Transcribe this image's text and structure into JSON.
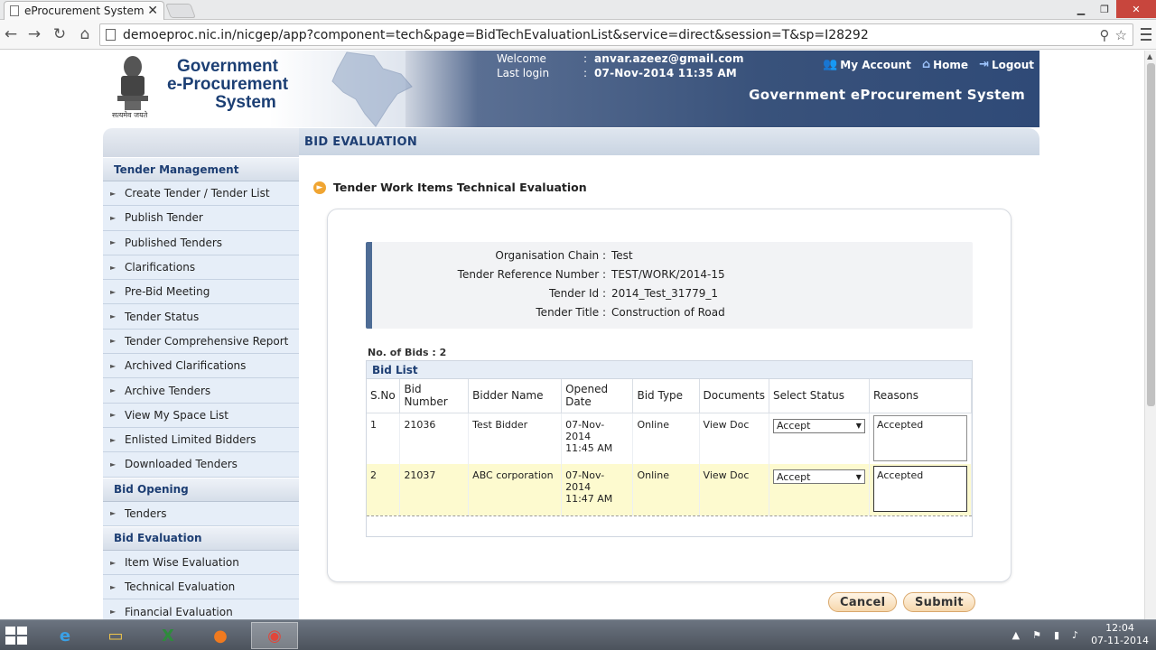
{
  "browser": {
    "tab_title": "eProcurement System",
    "tab_close": "✕",
    "url": "demoeproc.nic.in/nicgep/app?component=tech&page=BidTechEvaluationList&service=direct&session=T&sp=I28292"
  },
  "header": {
    "logo_lines": [
      "Government",
      "e-Procurement",
      "System"
    ],
    "emblem_caption": "सत्यमेव जयते",
    "welcome_label": "Welcome",
    "welcome_value": "anvar.azeez@gmail.com",
    "last_login_label": "Last login",
    "last_login_value": "07-Nov-2014 11:35 AM",
    "links": {
      "my_account": "My Account",
      "home": "Home",
      "logout": "Logout"
    },
    "system_title": "Government eProcurement System"
  },
  "sidebar": {
    "groups": [
      {
        "title": "Tender Management",
        "items": [
          "Create Tender / Tender List",
          "Publish Tender",
          "Published Tenders",
          "Clarifications",
          "Pre-Bid Meeting",
          "Tender Status",
          "Tender Comprehensive Report",
          "Archived Clarifications",
          "Archive Tenders",
          "View My Space List",
          "Enlisted Limited Bidders",
          "Downloaded Tenders"
        ]
      },
      {
        "title": "Bid Opening",
        "items": [
          "Tenders"
        ]
      },
      {
        "title": "Bid Evaluation",
        "items": [
          "Item Wise Evaluation",
          "Technical Evaluation",
          "Financial Evaluation"
        ]
      }
    ]
  },
  "main": {
    "heading": "BID EVALUATION",
    "section_title": "Tender Work Items Technical Evaluation",
    "info": {
      "org_label": "Organisation Chain :",
      "org_value": "Test",
      "ref_label": "Tender Reference Number :",
      "ref_value": "TEST/WORK/2014-15",
      "id_label": "Tender Id :",
      "id_value": "2014_Test_31779_1",
      "title_label": "Tender Title :",
      "title_value": "Construction of Road"
    },
    "bids_count": "No. of Bids : 2",
    "bid_list_title": "Bid List",
    "columns": [
      "S.No",
      "Bid Number",
      "Bidder Name",
      "Opened Date",
      "Bid Type",
      "Documents",
      "Select Status",
      "Reasons"
    ],
    "rows": [
      {
        "sno": "1",
        "bid_number": "21036",
        "bidder": "Test Bidder",
        "date": "07-Nov-2014",
        "time": "11:45 AM",
        "type": "Online",
        "docs": "View Doc",
        "status": "Accept",
        "reason": "Accepted"
      },
      {
        "sno": "2",
        "bid_number": "21037",
        "bidder": "ABC corporation",
        "date": "07-Nov-2014",
        "time": "11:47 AM",
        "type": "Online",
        "docs": "View Doc",
        "status": "Accept",
        "reason": "Accepted"
      }
    ],
    "cancel_label": "Cancel",
    "submit_label": "Submit"
  },
  "taskbar": {
    "time": "12:04",
    "date": "07-11-2014"
  },
  "colors": {
    "brand_blue": "#1d3e73",
    "banner_blue": "#2f4a77",
    "button_orange": "#f6d7ac",
    "highlight_row": "#fdfacf"
  }
}
